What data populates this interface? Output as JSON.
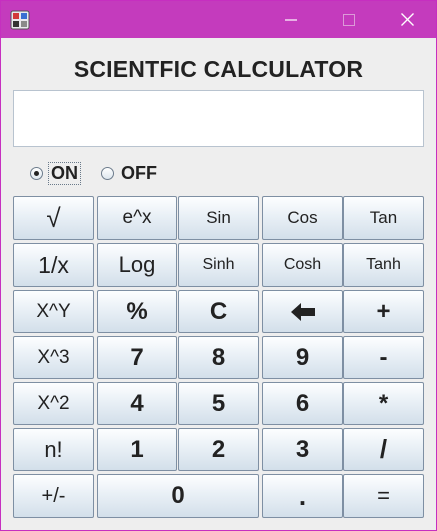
{
  "window": {
    "title_bar_color": "#c43bbd",
    "icons": {
      "app": "calculator-app-icon",
      "minimize": "minimize-icon",
      "maximize": "maximize-icon",
      "close": "close-icon"
    }
  },
  "title": "SCIENTFIC CALCULATOR",
  "display": {
    "value": ""
  },
  "power": {
    "selected": "ON",
    "on_label": "ON",
    "off_label": "OFF"
  },
  "keys": {
    "sqrt": "√",
    "exp": "e^x",
    "sin": "Sin",
    "cos": "Cos",
    "tan": "Tan",
    "reciprocal": "1/x",
    "log": "Log",
    "sinh": "Sinh",
    "cosh": "Cosh",
    "tanh": "Tanh",
    "power_xy": "X^Y",
    "percent": "%",
    "clear": "C",
    "backspace_icon": "left-arrow-icon",
    "plus": "+",
    "cube": "X^3",
    "seven": "7",
    "eight": "8",
    "nine": "9",
    "minus": "-",
    "square": "X^2",
    "four": "4",
    "five": "5",
    "six": "6",
    "multiply": "*",
    "factorial": "n!",
    "one": "1",
    "two": "2",
    "three": "3",
    "divide": "/",
    "sign": "+/-",
    "zero": "0",
    "dot": ".",
    "equals": "="
  }
}
